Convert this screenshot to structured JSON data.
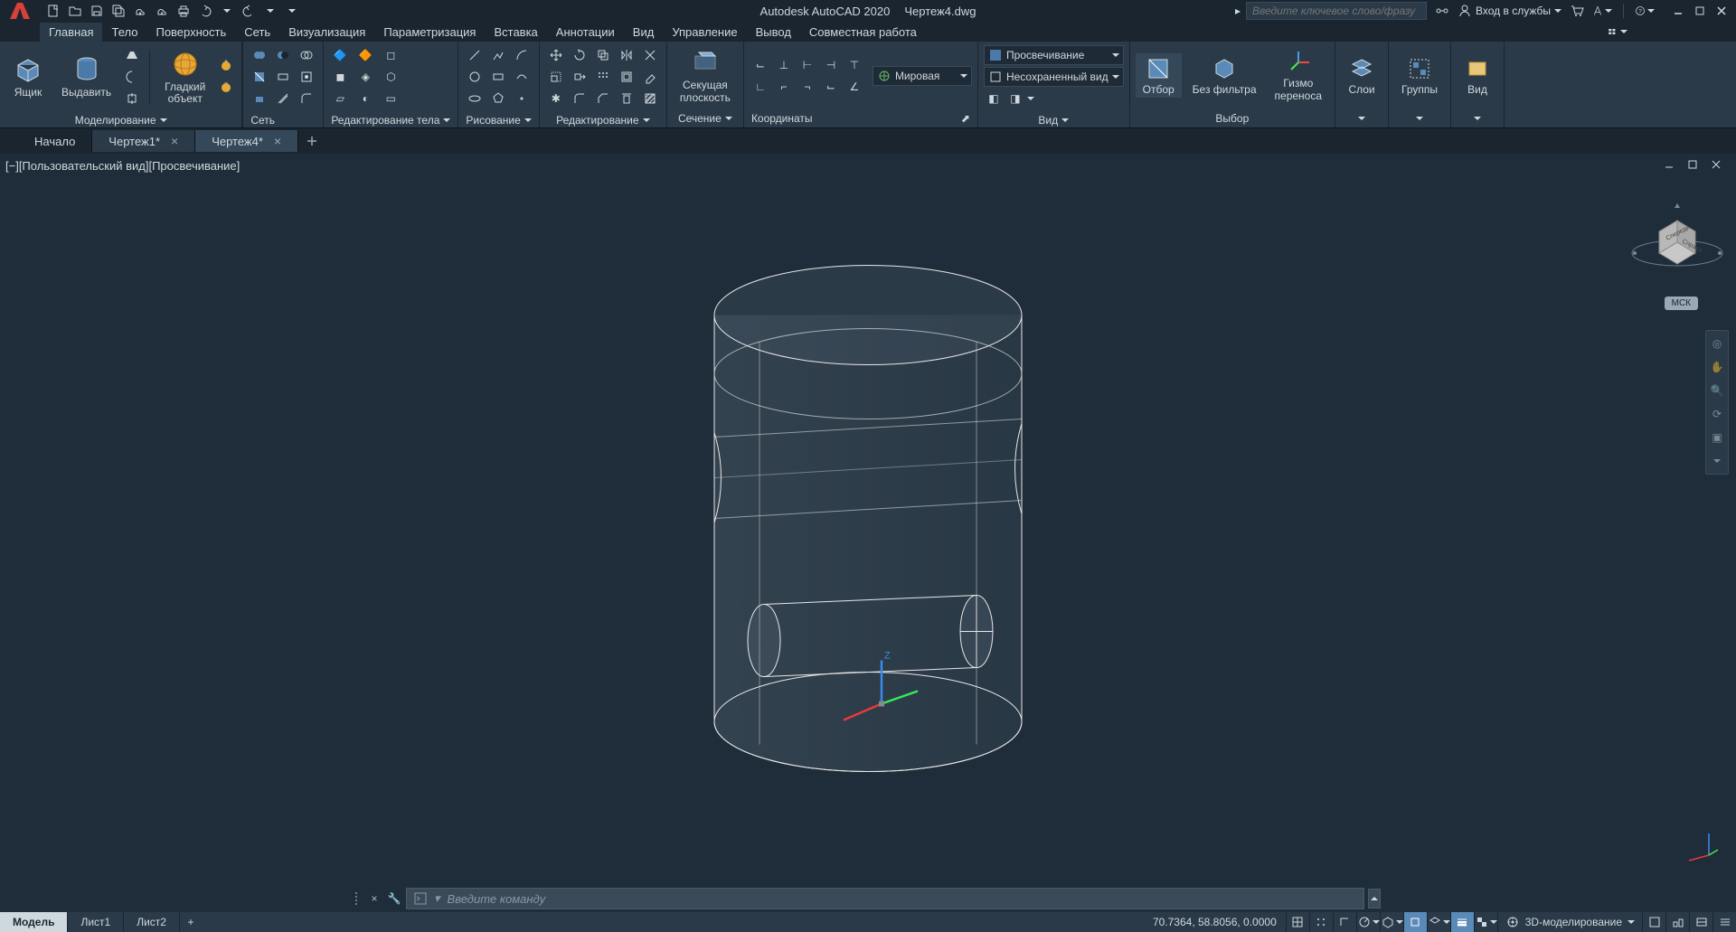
{
  "app": {
    "name": "Autodesk AutoCAD 2020",
    "file": "Чертеж4.dwg"
  },
  "search_placeholder": "Введите ключевое слово/фразу",
  "login_label": "Вход в службы",
  "menu_tabs": [
    "Главная",
    "Тело",
    "Поверхность",
    "Сеть",
    "Визуализация",
    "Параметризация",
    "Вставка",
    "Аннотации",
    "Вид",
    "Управление",
    "Вывод",
    "Совместная работа"
  ],
  "active_menu": 0,
  "ribbon": {
    "modeling": {
      "title": "Моделирование",
      "box": "Ящик",
      "extrude": "Выдавить",
      "smooth": "Гладкий\nобъект"
    },
    "mesh": {
      "title": "Сеть"
    },
    "solidedit": {
      "title": "Редактирование тела"
    },
    "draw": {
      "title": "Рисование"
    },
    "modify": {
      "title": "Редактирование"
    },
    "section": {
      "title": "Сечение",
      "slice": "Секущая\nплоскость"
    },
    "coords": {
      "title": "Координаты",
      "world": "Мировая"
    },
    "view": {
      "title": "Вид",
      "style": "Просвечивание",
      "unsaved": "Несохраненный вид"
    },
    "selection": {
      "title": "Выбор",
      "filter_off": "Отбор",
      "no_filter": "Без фильтра",
      "gizmo": "Гизмо\nпереноса"
    },
    "layers": {
      "title": "Слои"
    },
    "groups": {
      "title": "Группы"
    },
    "viewpanel": {
      "title": "Вид"
    }
  },
  "doc_tabs": {
    "start": "Начало",
    "files": [
      "Чертеж1*",
      "Чертеж4*"
    ],
    "active": 1
  },
  "viewport_label": "[−][Пользовательский вид][Просвечивание]",
  "wcs": "МСК",
  "viewcube": {
    "front": "Спереди",
    "right": "Справа",
    "top": ""
  },
  "cmd_placeholder": "Введите  команду",
  "layout_tabs": [
    "Модель",
    "Лист1",
    "Лист2"
  ],
  "active_layout": 0,
  "coords": "70.7364, 58.8056, 0.0000",
  "workspace": "3D-моделирование"
}
